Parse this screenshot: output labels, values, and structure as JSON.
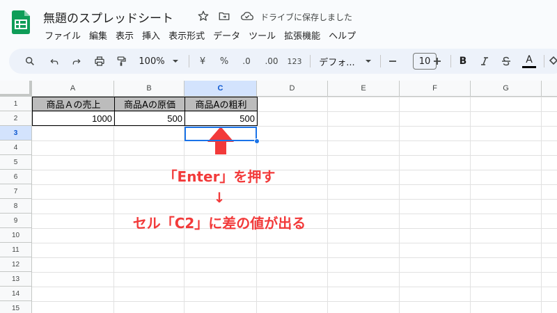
{
  "app": {
    "doc_title": "無題のスプレッドシート",
    "save_status": "ドライブに保存しました"
  },
  "menu": [
    "ファイル",
    "編集",
    "表示",
    "挿入",
    "表示形式",
    "データ",
    "ツール",
    "拡張機能",
    "ヘルプ"
  ],
  "toolbar": {
    "zoom": "100%",
    "currency": "¥",
    "percent": "%",
    "decrease_decimal": ".0",
    "increase_decimal": ".00",
    "more_formats": "123",
    "font_name": "デフォ...",
    "font_size": "10",
    "bold": "B",
    "underline_text": "A"
  },
  "columns": [
    "A",
    "B",
    "C",
    "D",
    "E",
    "F",
    "G"
  ],
  "rows": [
    "1",
    "2",
    "3",
    "4",
    "5",
    "6",
    "7",
    "8",
    "9",
    "10",
    "11",
    "12",
    "13",
    "14",
    "15"
  ],
  "cells": {
    "A1": "商品Ａの売上",
    "B1": "商品Aの原価",
    "C1": "商品Aの粗利",
    "A2": "1000",
    "B2": "500",
    "C2": "500"
  },
  "selection": {
    "cell": "C3",
    "column": "C",
    "row": "3"
  },
  "annotation": {
    "line1": "「Enter」を押す",
    "line2": "↓",
    "line3": "セル「C2」に差の値が出る",
    "color": "#f23a3a"
  },
  "colors": {
    "header_fill": "#bcbcbc",
    "selection_blue": "#1a73e8",
    "sheets_green": "#0f9d58"
  }
}
